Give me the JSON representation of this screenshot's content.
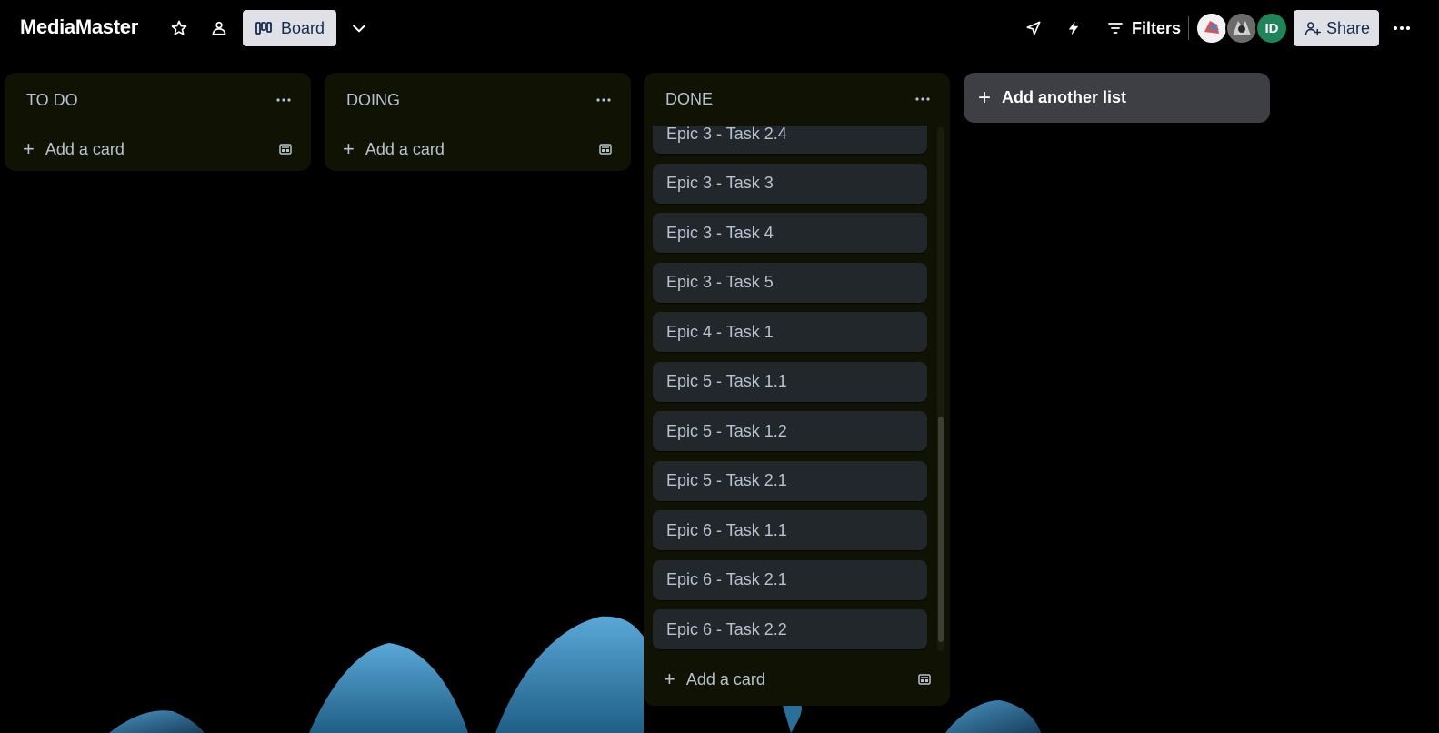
{
  "header": {
    "board_name": "MediaMaster",
    "view_label": "Board",
    "filters_label": "Filters",
    "share_label": "Share",
    "member_initials": "ID"
  },
  "lists": {
    "todo": {
      "title": "TO DO",
      "add_card_label": "Add a card",
      "cards": []
    },
    "doing": {
      "title": "DOING",
      "add_card_label": "Add a card",
      "cards": []
    },
    "done": {
      "title": "DONE",
      "add_card_label": "Add a card",
      "cards": [
        "Epic 3 - Task 2.4",
        "Epic 3 - Task 3",
        "Epic 3 - Task 4",
        "Epic 3 - Task 5",
        "Epic 4 - Task 1",
        "Epic 5 - Task 1.1",
        "Epic 5 - Task 1.2",
        "Epic 5 - Task 2.1",
        "Epic 6 - Task 1.1",
        "Epic 6 - Task 2.1",
        "Epic 6 - Task 2.2"
      ]
    }
  },
  "add_list_label": "Add another list",
  "colors": {
    "list_bg": "#101204",
    "card_bg": "#22272b",
    "text": "#b6c2cf",
    "avatar_green": "#1f845a"
  }
}
